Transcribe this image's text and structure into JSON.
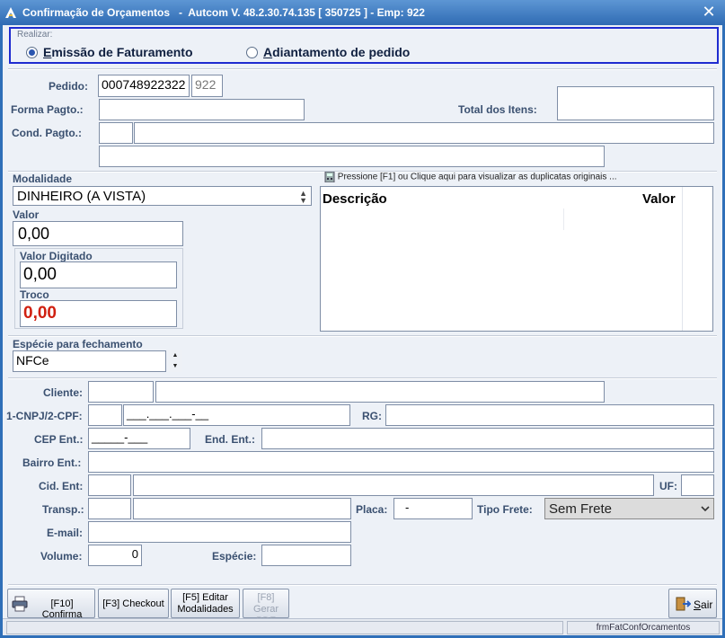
{
  "window": {
    "title": "Confirmação de Orçamentos   -  Autcom V. 48.2.30.74.135 [ 350725 ] - Emp: 922",
    "close_glyph": "✕"
  },
  "realizar": {
    "legend": "Realizar:",
    "option1": {
      "accel": "E",
      "rest": "missão de Faturamento",
      "selected": true
    },
    "option2": {
      "accel": "A",
      "rest": "diantamento de pedido",
      "selected": false
    }
  },
  "order": {
    "pedido_label": "Pedido:",
    "pedido_value": "00074892232",
    "pedido_suffix": "2",
    "emp_value": "922",
    "forma_label": "Forma Pagto.:",
    "forma_value": "",
    "total_label": "Total dos Itens:",
    "total_value": "",
    "cond_label": "Cond. Pagto.:",
    "cond_code": "",
    "cond_desc": "",
    "cond_extra": ""
  },
  "payment": {
    "modalidade_label": "Modalidade",
    "modalidade_value": "DINHEIRO (A VISTA)",
    "valor_label": "Valor",
    "valor_value": "0,00",
    "valor_digitado_label": "Valor Digitado",
    "valor_digitado_value": "0,00",
    "troco_label": "Troco",
    "troco_value": "0,00",
    "troco_color": "#d02010",
    "duplicatas_hint": "Pressione [F1] ou Clique aqui para visualizar as duplicatas originais ...",
    "grid_columns": [
      "Descrição",
      "Valor"
    ]
  },
  "closing": {
    "especie_label": "Espécie para fechamento",
    "especie_value": "NFCe"
  },
  "customer": {
    "cliente_label": "Cliente:",
    "cliente_code": "",
    "cliente_name": "",
    "cnpj_label": "1-CNPJ/2-CPF:",
    "cnpj_type": "",
    "cnpj_mask": "___.___.___-__",
    "rg_label": "RG:",
    "rg_value": "",
    "cep_label": "CEP Ent.:",
    "cep_mask": "_____-___",
    "end_label": "End. Ent.:",
    "end_value": "",
    "bairro_label": "Bairro Ent.:",
    "bairro_value": "",
    "cid_label": "Cid. Ent:",
    "cid_code": "",
    "cid_name": "",
    "uf_label": "UF:",
    "uf_value": "",
    "transp_label": "Transp.:",
    "transp_code": "",
    "transp_name": "",
    "placa_label": "Placa:",
    "placa_value": "-",
    "frete_label": "Tipo Frete:",
    "frete_value": "Sem Frete",
    "email_label": "E-mail:",
    "email_value": "",
    "volume_label": "Volume:",
    "volume_value": "0",
    "especie_label": "Espécie:",
    "especie_value": ""
  },
  "buttons": {
    "confirma": "[F10] Confirma",
    "checkout": "[F3] Checkout",
    "editar_line1": "[F5] Editar",
    "editar_line2": "Modalidades",
    "gerar_line1": "[F8] Gerar",
    "gerar_line2": "PDF",
    "sair_accel": "S",
    "sair_rest": "air"
  },
  "status": {
    "form_name": "frmFatConfOrcamentos"
  },
  "colors": {
    "titlebar": "#2f6bb3",
    "label": "#3a5070",
    "focus_border": "#1e2bd0"
  }
}
